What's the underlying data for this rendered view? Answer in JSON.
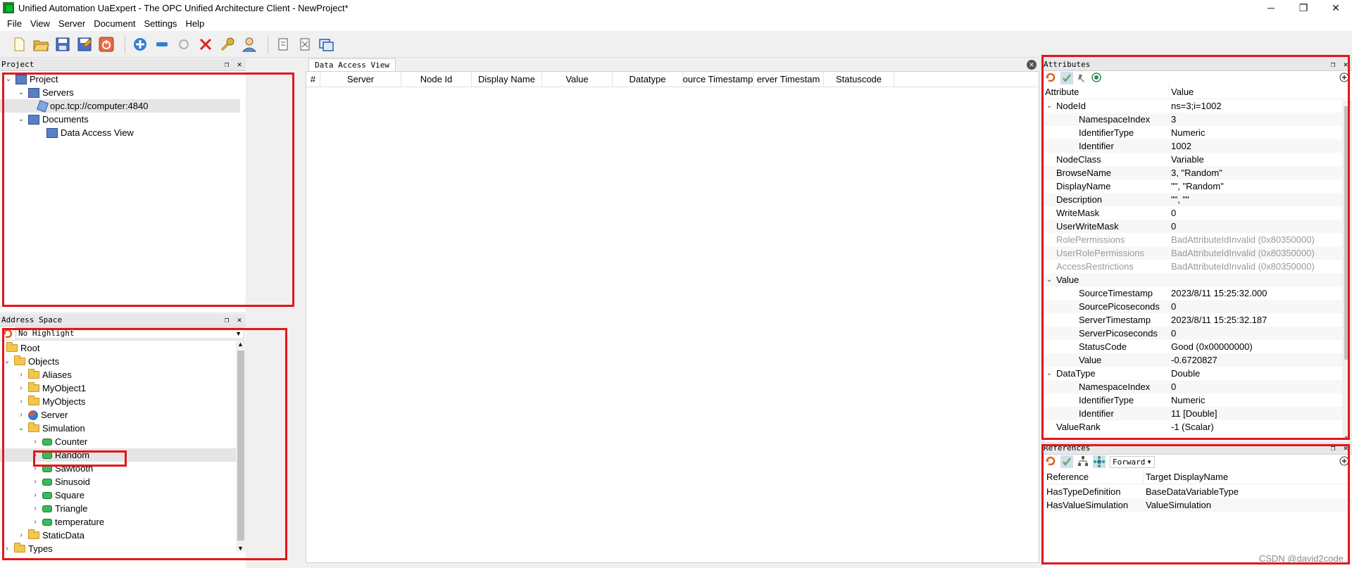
{
  "window": {
    "title": "Unified Automation UaExpert - The OPC Unified Architecture Client - NewProject*",
    "minimize": "─",
    "restore": "❐",
    "close": "✕"
  },
  "menu": [
    {
      "label": "File"
    },
    {
      "label": "View"
    },
    {
      "label": "Server"
    },
    {
      "label": "Document"
    },
    {
      "label": "Settings"
    },
    {
      "label": "Help"
    }
  ],
  "project_panel": {
    "title": "Project",
    "root": "Project",
    "servers": "Servers",
    "server_url": "opc.tcp://computer:4840",
    "documents": "Documents",
    "document_item": "Data Access View"
  },
  "address_panel": {
    "title": "Address Space",
    "highlight_select": "No Highlight",
    "root": "Root",
    "objects": "Objects",
    "aliases": "Aliases",
    "myobject1": "MyObject1",
    "myobjects": "MyObjects",
    "server": "Server",
    "simulation": "Simulation",
    "counter": "Counter",
    "random": "Random",
    "sawtooth": "Sawtooth",
    "sinusoid": "Sinusoid",
    "square": "Square",
    "triangle": "Triangle",
    "temperature": "temperature",
    "staticdata": "StaticData",
    "types": "Types"
  },
  "data_access_view": {
    "tab": "Data Access View",
    "columns": [
      "#",
      "Server",
      "Node Id",
      "Display Name",
      "Value",
      "Datatype",
      "ource Timestamp",
      "erver Timestam",
      "Statuscode"
    ]
  },
  "attributes_panel": {
    "title": "Attributes",
    "col_attribute": "Attribute",
    "col_value": "Value",
    "rows": [
      {
        "name": "NodeId",
        "value": "ns=3;i=1002",
        "level": 0,
        "expanded": true
      },
      {
        "name": "NamespaceIndex",
        "value": "3",
        "level": 1
      },
      {
        "name": "IdentifierType",
        "value": "Numeric",
        "level": 1
      },
      {
        "name": "Identifier",
        "value": "1002",
        "level": 1
      },
      {
        "name": "NodeClass",
        "value": "Variable",
        "level": 0
      },
      {
        "name": "BrowseName",
        "value": "3, \"Random\"",
        "level": 0
      },
      {
        "name": "DisplayName",
        "value": "\"\", \"Random\"",
        "level": 0
      },
      {
        "name": "Description",
        "value": "\"\", \"\"",
        "level": 0
      },
      {
        "name": "WriteMask",
        "value": "0",
        "level": 0
      },
      {
        "name": "UserWriteMask",
        "value": "0",
        "level": 0
      },
      {
        "name": "RolePermissions",
        "value": "BadAttributeIdInvalid (0x80350000)",
        "level": 0,
        "disabled": true
      },
      {
        "name": "UserRolePermissions",
        "value": "BadAttributeIdInvalid (0x80350000)",
        "level": 0,
        "disabled": true
      },
      {
        "name": "AccessRestrictions",
        "value": "BadAttributeIdInvalid (0x80350000)",
        "level": 0,
        "disabled": true
      },
      {
        "name": "Value",
        "value": "",
        "level": 0,
        "expanded": true
      },
      {
        "name": "SourceTimestamp",
        "value": "2023/8/11 15:25:32.000",
        "level": 1
      },
      {
        "name": "SourcePicoseconds",
        "value": "0",
        "level": 1
      },
      {
        "name": "ServerTimestamp",
        "value": "2023/8/11 15:25:32.187",
        "level": 1
      },
      {
        "name": "ServerPicoseconds",
        "value": "0",
        "level": 1
      },
      {
        "name": "StatusCode",
        "value": "Good (0x00000000)",
        "level": 1
      },
      {
        "name": "Value",
        "value": "-0.6720827",
        "level": 1
      },
      {
        "name": "DataType",
        "value": "Double",
        "level": 0,
        "expanded": true
      },
      {
        "name": "NamespaceIndex",
        "value": "0",
        "level": 1
      },
      {
        "name": "IdentifierType",
        "value": "Numeric",
        "level": 1
      },
      {
        "name": "Identifier",
        "value": "11 [Double]",
        "level": 1
      },
      {
        "name": "ValueRank",
        "value": "-1 (Scalar)",
        "level": 0
      }
    ]
  },
  "references_panel": {
    "title": "References",
    "direction": "Forward",
    "col_reference": "Reference",
    "col_target": "Target DisplayName",
    "rows": [
      {
        "reference": "HasTypeDefinition",
        "target": "BaseDataVariableType"
      },
      {
        "reference": "HasValueSimulation",
        "target": "ValueSimulation"
      }
    ]
  },
  "watermark": "CSDN @david2code"
}
